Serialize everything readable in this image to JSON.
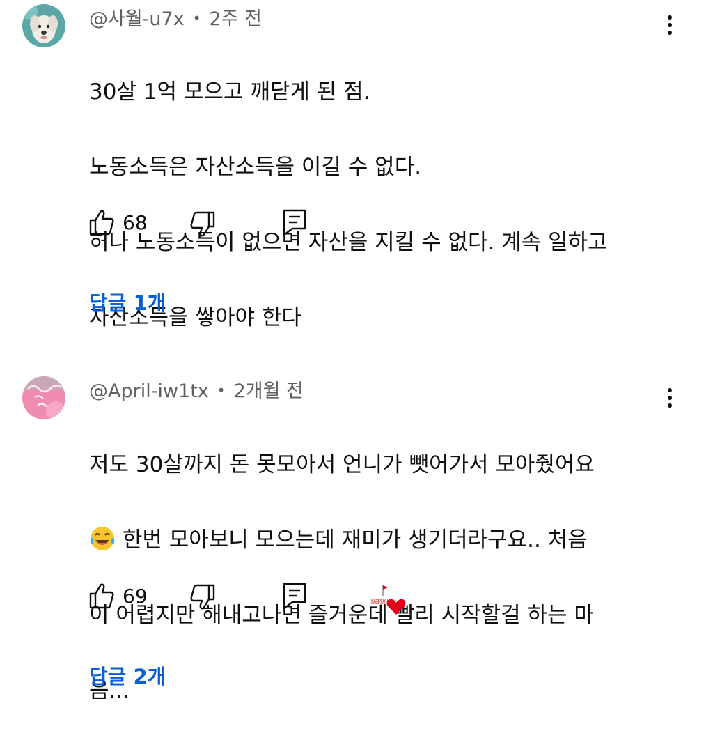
{
  "comments": [
    {
      "author": "@사월-u7x",
      "separator": "•",
      "time": "2주 전",
      "text_lines": [
        "30살 1억 모으고 깨닫게 된 점.",
        "노동소득은 자산소득을 이길 수 없다.",
        "허나 노동소득이 없으면 자산을 지킬 수 없다. 계속 일하고",
        "자산소득을 쌓아야 한다"
      ],
      "likes": "68",
      "replies_label": "답글 1개",
      "avatar_icon": "dog-avatar-icon"
    },
    {
      "author": "@April-iw1tx",
      "separator": "•",
      "time": "2개월 전",
      "text_lines": [
        "저도 30살까지 돈 못모아서 언니가 뺏어가서 모아줬어요",
        " 한번 모아보니 모으는데 재미가 생기더라구요.. 처음",
        "이 어렵지만 해내고나면 즐거운데 빨리 시작할걸 하는 마",
        "음..."
      ],
      "likes": "69",
      "replies_label": "답글 2개",
      "avatar_icon": "neon-sign-avatar-icon",
      "creator_heart_caption": "월급쟁이 TV"
    }
  ],
  "colors": {
    "text": "#0f0f0f",
    "meta": "#606060",
    "link": "#065fd4",
    "heart": "#e0001b"
  }
}
